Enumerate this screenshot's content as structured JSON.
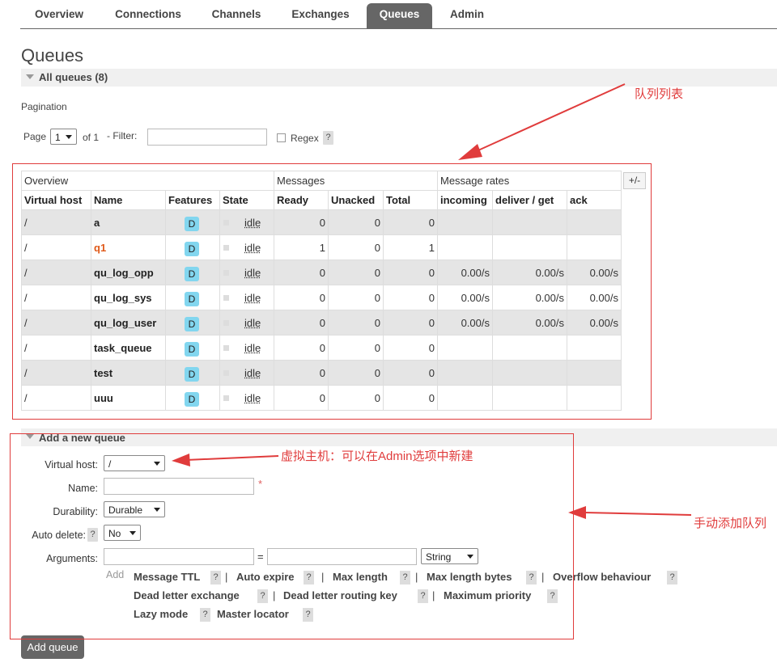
{
  "nav": {
    "tabs": [
      {
        "label": "Overview",
        "active": false
      },
      {
        "label": "Connections",
        "active": false
      },
      {
        "label": "Channels",
        "active": false
      },
      {
        "label": "Exchanges",
        "active": false
      },
      {
        "label": "Queues",
        "active": true
      },
      {
        "label": "Admin",
        "active": false
      }
    ]
  },
  "page": {
    "title": "Queues",
    "all_queues": "All queues (8)",
    "pagination_label": "Pagination",
    "page_label": "Page",
    "page_value": "1",
    "of_label": "of 1",
    "filter_label": "- Filter:",
    "regex_label": "Regex",
    "qmark": "?"
  },
  "table": {
    "group_headers": [
      "Overview",
      "Messages",
      "Message rates"
    ],
    "columns": [
      "Virtual host",
      "Name",
      "Features",
      "State",
      "Ready",
      "Unacked",
      "Total",
      "incoming",
      "deliver / get",
      "ack"
    ],
    "plus_minus": "+/-",
    "rows": [
      {
        "vhost": "/",
        "name": "a",
        "feature": "D",
        "state": "idle",
        "ready": "0",
        "unacked": "0",
        "total": "0",
        "incoming": "",
        "deliver": "",
        "ack": "",
        "highlight": false
      },
      {
        "vhost": "/",
        "name": "q1",
        "feature": "D",
        "state": "idle",
        "ready": "1",
        "unacked": "0",
        "total": "1",
        "incoming": "",
        "deliver": "",
        "ack": "",
        "highlight": true
      },
      {
        "vhost": "/",
        "name": "qu_log_opp",
        "feature": "D",
        "state": "idle",
        "ready": "0",
        "unacked": "0",
        "total": "0",
        "incoming": "0.00/s",
        "deliver": "0.00/s",
        "ack": "0.00/s",
        "highlight": false
      },
      {
        "vhost": "/",
        "name": "qu_log_sys",
        "feature": "D",
        "state": "idle",
        "ready": "0",
        "unacked": "0",
        "total": "0",
        "incoming": "0.00/s",
        "deliver": "0.00/s",
        "ack": "0.00/s",
        "highlight": false
      },
      {
        "vhost": "/",
        "name": "qu_log_user",
        "feature": "D",
        "state": "idle",
        "ready": "0",
        "unacked": "0",
        "total": "0",
        "incoming": "0.00/s",
        "deliver": "0.00/s",
        "ack": "0.00/s",
        "highlight": false
      },
      {
        "vhost": "/",
        "name": "task_queue",
        "feature": "D",
        "state": "idle",
        "ready": "0",
        "unacked": "0",
        "total": "0",
        "incoming": "",
        "deliver": "",
        "ack": "",
        "highlight": false
      },
      {
        "vhost": "/",
        "name": "test",
        "feature": "D",
        "state": "idle",
        "ready": "0",
        "unacked": "0",
        "total": "0",
        "incoming": "",
        "deliver": "",
        "ack": "",
        "highlight": false
      },
      {
        "vhost": "/",
        "name": "uuu",
        "feature": "D",
        "state": "idle",
        "ready": "0",
        "unacked": "0",
        "total": "0",
        "incoming": "",
        "deliver": "",
        "ack": "",
        "highlight": false
      }
    ]
  },
  "add_queue": {
    "section_title": "Add a new queue",
    "virtual_host_label": "Virtual host:",
    "virtual_host_value": "/",
    "name_label": "Name:",
    "required_mark": "*",
    "durability_label": "Durability:",
    "durability_value": "Durable",
    "auto_delete_label": "Auto delete:",
    "auto_delete_value": "No",
    "arguments_label": "Arguments:",
    "equals": "=",
    "arg_type_value": "String",
    "add_label": "Add",
    "arg_links_row1": [
      "Message TTL",
      "Auto expire",
      "Max length",
      "Max length bytes",
      "Overflow behaviour"
    ],
    "arg_links_row2": [
      "Dead letter exchange",
      "Dead letter routing key",
      "Maximum priority"
    ],
    "arg_links_row3": [
      "Lazy mode",
      "Master locator"
    ],
    "separator": "|",
    "button_label": "Add queue"
  },
  "annotations": {
    "queue_list": "队列列表",
    "virtual_host_note": "虚拟主机：可以在Admin选项中新建",
    "manual_add": "手动添加队列"
  },
  "colors": {
    "annotation_red": "#e03c3c",
    "highlight_orange": "#e05a1a",
    "feature_badge": "#82d6ef",
    "nav_active": "#666666"
  }
}
